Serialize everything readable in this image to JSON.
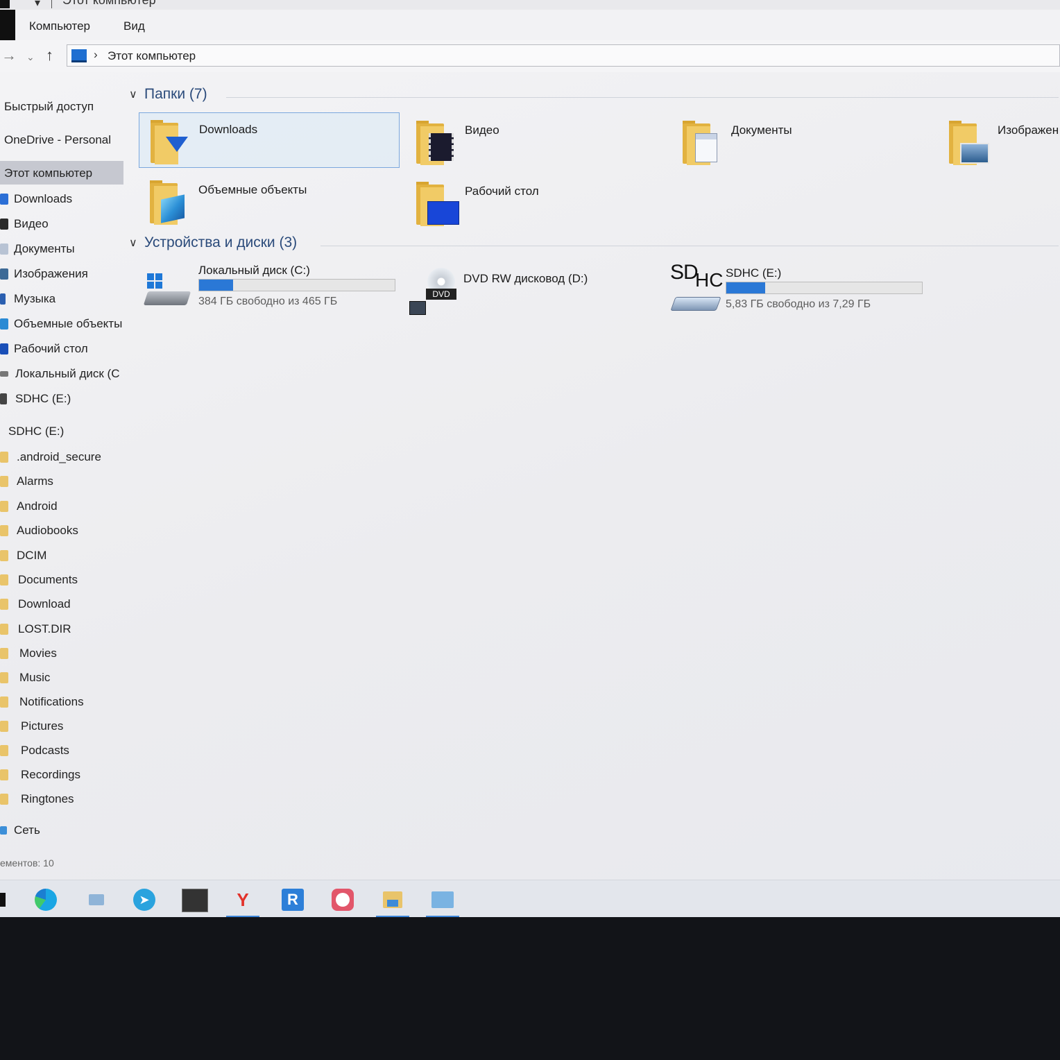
{
  "window": {
    "title": "Этот компьютер"
  },
  "ribbon": {
    "tabs": [
      "Компьютер",
      "Вид"
    ]
  },
  "address": {
    "crumb": "Этот компьютер"
  },
  "nav": {
    "items": [
      "Быстрый доступ",
      "OneDrive - Personal",
      "Этот компьютер",
      "Downloads",
      "Видео",
      "Документы",
      "Изображения",
      "Музыка",
      "Объемные объекты",
      "Рабочий стол",
      "Локальный диск (C",
      "SDHC (E:)",
      "SDHC (E:)",
      ".android_secure",
      "Alarms",
      "Android",
      "Audiobooks",
      "DCIM",
      "Documents",
      "Download",
      "LOST.DIR",
      "Movies",
      "Music",
      "Notifications",
      "Pictures",
      "Podcasts",
      "Recordings",
      "Ringtones",
      "Сеть"
    ]
  },
  "folders": {
    "header": "Папки (7)",
    "items": [
      "Downloads",
      "Видео",
      "Документы",
      "Изображен",
      "Объемные объекты",
      "Рабочий стол"
    ]
  },
  "devices": {
    "header": "Устройства и диски (3)",
    "items": [
      {
        "name": "Локальный диск (C:)",
        "space": "384 ГБ свободно из 465 ГБ",
        "used_fraction": 0.174
      },
      {
        "name": "DVD RW дисковод (D:)",
        "space": "",
        "used_fraction": null
      },
      {
        "name": "SDHC (E:)",
        "space": "5,83 ГБ свободно из 7,29 ГБ",
        "used_fraction": 0.2
      }
    ],
    "icon_texts": {
      "dvd": "DVD",
      "sd": "SD",
      "hc": "HC"
    }
  },
  "status": {
    "text": "ементов: 10"
  },
  "taskbar": {
    "items": [
      "edge-icon",
      "files-icon",
      "telegram-icon",
      "app-icon",
      "yandex-icon",
      "app-r-icon",
      "clock-app-icon",
      "explorer-icon",
      "photos-icon"
    ]
  }
}
